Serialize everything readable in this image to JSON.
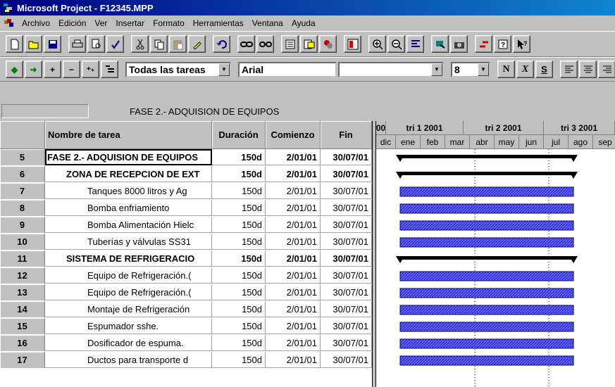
{
  "window": {
    "title": "Microsoft Project - F12345.MPP"
  },
  "menu": [
    "Archivo",
    "Edición",
    "Ver",
    "Insertar",
    "Formato",
    "Herramientas",
    "Ventana",
    "Ayuda"
  ],
  "toolbar2": {
    "filter_value": "Todas las tareas",
    "font_value": "Arial",
    "size_value": "8",
    "bold_label": "N",
    "italic_label": "X",
    "underline_label": "S"
  },
  "entry_bar": {
    "value": "FASE 2.- ADQUISION DE EQUIPOS"
  },
  "table": {
    "headers": {
      "name": "Nombre de tarea",
      "duration": "Duración",
      "start": "Comienzo",
      "end": "Fin"
    },
    "rows": [
      {
        "id": "5",
        "name": "FASE 2.- ADQUISION DE EQUIPOS",
        "duration": "150d",
        "start": "2/01/01",
        "end": "30/07/01",
        "summary": true,
        "indent": 0
      },
      {
        "id": "6",
        "name": "ZONA DE RECEPCION DE EXT",
        "duration": "150d",
        "start": "2/01/01",
        "end": "30/07/01",
        "summary": true,
        "indent": 1
      },
      {
        "id": "7",
        "name": "Tanques 8000 litros y Ag",
        "duration": "150d",
        "start": "2/01/01",
        "end": "30/07/01",
        "summary": false,
        "indent": 2
      },
      {
        "id": "8",
        "name": "Bomba enfriamiento",
        "duration": "150d",
        "start": "2/01/01",
        "end": "30/07/01",
        "summary": false,
        "indent": 2
      },
      {
        "id": "9",
        "name": "Bomba Alimentación Hielc",
        "duration": "150d",
        "start": "2/01/01",
        "end": "30/07/01",
        "summary": false,
        "indent": 2
      },
      {
        "id": "10",
        "name": "Tuberías y válvulas SS31",
        "duration": "150d",
        "start": "2/01/01",
        "end": "30/07/01",
        "summary": false,
        "indent": 2
      },
      {
        "id": "11",
        "name": "SISTEMA DE REFRIGERACIO",
        "duration": "150d",
        "start": "2/01/01",
        "end": "30/07/01",
        "summary": true,
        "indent": 1
      },
      {
        "id": "12",
        "name": "Equipo de Refrigeración.(",
        "duration": "150d",
        "start": "2/01/01",
        "end": "30/07/01",
        "summary": false,
        "indent": 2
      },
      {
        "id": "13",
        "name": "Equipo de Refrigeración.(",
        "duration": "150d",
        "start": "2/01/01",
        "end": "30/07/01",
        "summary": false,
        "indent": 2
      },
      {
        "id": "14",
        "name": "Montaje de Refrigeración",
        "duration": "150d",
        "start": "2/01/01",
        "end": "30/07/01",
        "summary": false,
        "indent": 2
      },
      {
        "id": "15",
        "name": "Espumador sshe.",
        "duration": "150d",
        "start": "2/01/01",
        "end": "30/07/01",
        "summary": false,
        "indent": 2
      },
      {
        "id": "16",
        "name": "Dosificador de espuma.",
        "duration": "150d",
        "start": "2/01/01",
        "end": "30/07/01",
        "summary": false,
        "indent": 2
      },
      {
        "id": "17",
        "name": "Ductos para transporte d",
        "duration": "150d",
        "start": "2/01/01",
        "end": "30/07/01",
        "summary": false,
        "indent": 2
      }
    ]
  },
  "timescale": {
    "major": [
      "00",
      "tri 1 2001",
      "tri 2 2001",
      "tri 3 2001"
    ],
    "minor": [
      "dic",
      "ene",
      "feb",
      "mar",
      "abr",
      "may",
      "jun",
      "jul",
      "ago",
      "sep"
    ]
  },
  "colors": {
    "task_bar": "#3232d8",
    "summary_bar": "#000000",
    "title_bar": "#000080"
  }
}
